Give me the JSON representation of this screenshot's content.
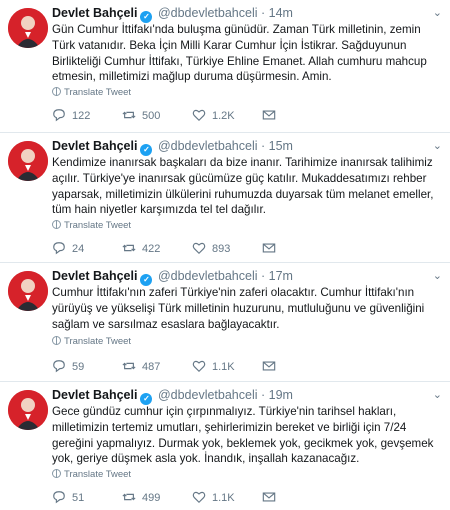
{
  "colors": {
    "name": "#14171a",
    "meta": "#657786",
    "verified": "#1da1f2",
    "divider": "#e1e8ed",
    "avatar_bg": "#d6222a"
  },
  "tweets": [
    {
      "name": "Devlet Bahçeli",
      "handle": "@dbdevletbahceli",
      "time": "· 14m",
      "text": "Gün Cumhur İttifakı'nda buluşma günüdür. Zaman Türk milletinin, zemin Türk vatanıdır. Beka İçin Milli Karar Cumhur İçin İstikrar. Sağduyunun Birlikteliği Cumhur İttifakı, Türkiye Ehline Emanet. Allah cumhuru mahcup etmesin, milletimizi mağlup duruma düşürmesin. Amin.",
      "translate": "Translate Tweet",
      "replies": "122",
      "retweets": "500",
      "likes": "1.2K"
    },
    {
      "name": "Devlet Bahçeli",
      "handle": "@dbdevletbahceli",
      "time": "· 15m",
      "text": "Kendimize inanırsak başkaları da bize inanır. Tarihimize inanırsak talihimiz açılır. Türkiye'ye inanırsak gücümüze güç katılır. Mukaddesatımızı rehber yaparsak, milletimizin ülkülerini ruhumuzda duyarsak tüm melanet emeller, tüm hain niyetler karşımızda tel tel dağılır.",
      "translate": "Translate Tweet",
      "replies": "24",
      "retweets": "422",
      "likes": "893"
    },
    {
      "name": "Devlet Bahçeli",
      "handle": "@dbdevletbahceli",
      "time": "· 17m",
      "text": "Cumhur İttifakı'nın zaferi Türkiye'nin zaferi olacaktır. Cumhur İttifakı'nın yürüyüş ve yükselişi Türk milletinin huzurunu, mutluluğunu ve güvenliğini sağlam ve sarsılmaz esaslara bağlayacaktır.",
      "translate": "Translate Tweet",
      "replies": "59",
      "retweets": "487",
      "likes": "1.1K"
    },
    {
      "name": "Devlet Bahçeli",
      "handle": "@dbdevletbahceli",
      "time": "· 19m",
      "text": "Gece gündüz cumhur için çırpınmalıyız. Türkiye'nin tarihsel hakları, milletimizin tertemiz umutları, şehirlerimizin bereket ve birliği için 7/24 gereğini yapmalıyız. Durmak yok, beklemek yok, gecikmek yok, gevşemek yok, geriye düşmek asla yok. İnandık, inşallah kazanacağız.",
      "translate": "Translate Tweet",
      "replies": "51",
      "retweets": "499",
      "likes": "1.1K"
    }
  ]
}
